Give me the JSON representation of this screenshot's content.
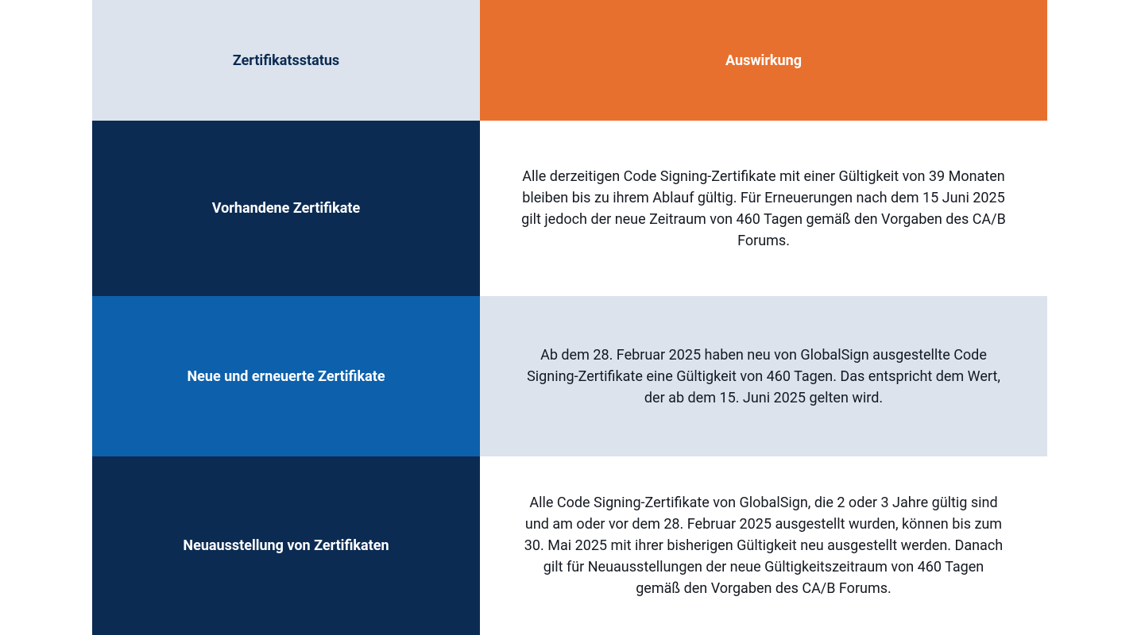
{
  "chart_data": {
    "type": "table",
    "title": "",
    "columns": [
      "Zertifikatsstatus",
      "Auswirkung"
    ],
    "rows": [
      {
        "status": "Vorhandene Zertifikate",
        "impact": "Alle derzeitigen Code Signing-Zertifikate mit einer Gültigkeit von 39 Monaten bleiben bis zu ihrem Ablauf gültig. Für Erneuerungen nach dem 15 Juni 2025 gilt jedoch der neue Zeitraum von 460 Tagen gemäß den Vorgaben des CA/B Forums."
      },
      {
        "status": "Neue und erneuerte Zertifikate",
        "impact": "Ab dem 28. Februar 2025 haben neu von GlobalSign ausgestellte Code Signing-Zertifikate eine Gültigkeit von 460 Tagen. Das entspricht dem Wert, der ab dem 15. Juni 2025 gelten wird."
      },
      {
        "status": "Neuausstellung von Zertifikaten",
        "impact": "Alle Code Signing-Zertifikate von GlobalSign, die 2 oder 3 Jahre gültig sind und am oder vor dem 28. Februar 2025 ausgestellt wurden, können bis zum 30. Mai 2025 mit ihrer bisherigen Gültigkeit neu ausgestellt werden. Danach gilt für Neuausstellungen der neue Gültigkeitszeitraum von 460 Tagen gemäß den Vorgaben des CA/B Forums."
      }
    ]
  }
}
